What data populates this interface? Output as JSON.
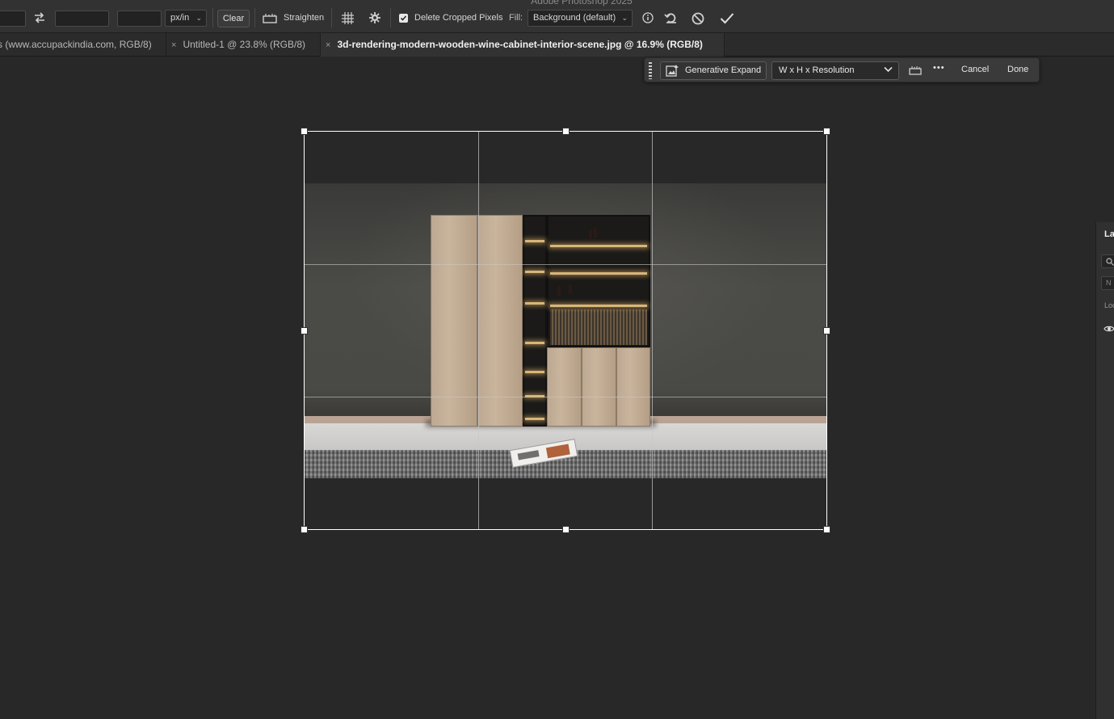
{
  "options_bar": {
    "title_fragment": "Adobe Photoshop 2025",
    "resolution_unit": "px/in",
    "clear_label": "Clear",
    "straighten_label": "Straighten",
    "delete_cropped_label": "Delete Cropped Pixels",
    "delete_cropped_checked": true,
    "fill_label": "Fill:",
    "fill_value": "Background (default)"
  },
  "tabs": [
    {
      "label": "s (www.accupackindia.com, RGB/8)",
      "active": false
    },
    {
      "label": "Untitled-1 @ 23.8% (RGB/8)",
      "active": false
    },
    {
      "label": "3d-rendering-modern-wooden-wine-cabinet-interior-scene.jpg @ 16.9% (RGB/8)",
      "active": true
    }
  ],
  "tab_close_glyph": "×",
  "context_bar": {
    "generative_expand_label": "Generative Expand",
    "ratio_value": "W x H x Resolution",
    "more_glyph": "•••",
    "cancel_label": "Cancel",
    "done_label": "Done"
  },
  "layers_panel": {
    "title": "La",
    "field_text": "N",
    "lock_label": "Loc"
  },
  "colors": {
    "canvas_bg": "#282828",
    "options_bar_bg": "#323232",
    "accent": "#ffffff"
  }
}
